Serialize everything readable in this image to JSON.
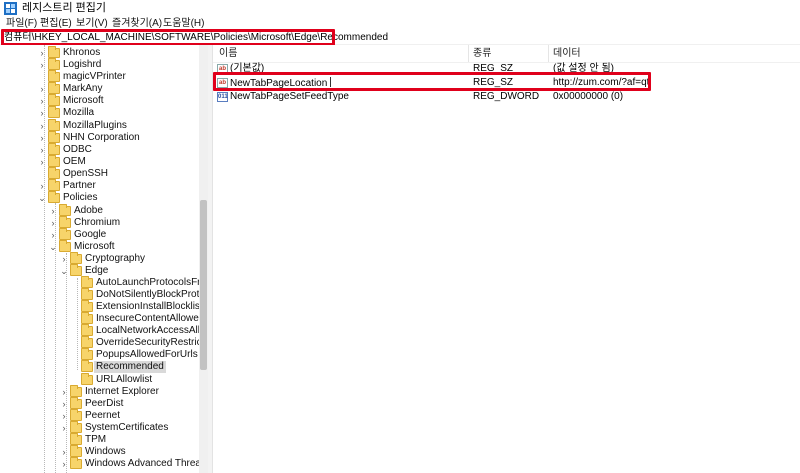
{
  "window": {
    "title": "레지스트리 편집기",
    "app_icon": "registry-icon"
  },
  "menu": [
    {
      "label": "파일(F)"
    },
    {
      "label": "편집(E)"
    },
    {
      "label": "보기(V)"
    },
    {
      "label": "즐겨찾기(A)"
    },
    {
      "label": "도움말(H)"
    }
  ],
  "address": {
    "path": "컴퓨터\\HKEY_LOCAL_MACHINE\\SOFTWARE\\Policies\\Microsoft\\Edge\\Recommended"
  },
  "tree": {
    "nodes": [
      {
        "label": "Khronos",
        "expander": "collapsed"
      },
      {
        "label": "Logishrd",
        "expander": "collapsed"
      },
      {
        "label": "magicVPrinter",
        "expander": "none"
      },
      {
        "label": "MarkAny",
        "expander": "collapsed"
      },
      {
        "label": "Microsoft",
        "expander": "collapsed"
      },
      {
        "label": "Mozilla",
        "expander": "collapsed"
      },
      {
        "label": "MozillaPlugins",
        "expander": "collapsed"
      },
      {
        "label": "NHN Corporation",
        "expander": "collapsed"
      },
      {
        "label": "ODBC",
        "expander": "collapsed"
      },
      {
        "label": "OEM",
        "expander": "collapsed"
      },
      {
        "label": "OpenSSH",
        "expander": "none"
      },
      {
        "label": "Partner",
        "expander": "collapsed"
      },
      {
        "label": "Policies",
        "expander": "expanded"
      },
      {
        "label": "Adobe",
        "expander": "collapsed"
      },
      {
        "label": "Chromium",
        "expander": "collapsed"
      },
      {
        "label": "Google",
        "expander": "collapsed"
      },
      {
        "label": "Microsoft",
        "expander": "expanded"
      },
      {
        "label": "Cryptography",
        "expander": "collapsed"
      },
      {
        "label": "Edge",
        "expander": "expanded"
      },
      {
        "label": "AutoLaunchProtocolsFromO",
        "expander": "none"
      },
      {
        "label": "DoNotSilentlyBlockProtocols",
        "expander": "none"
      },
      {
        "label": "ExtensionInstallBlocklist",
        "expander": "none"
      },
      {
        "label": "InsecureContentAllowedForU",
        "expander": "none"
      },
      {
        "label": "LocalNetworkAccessAllowed",
        "expander": "none"
      },
      {
        "label": "OverrideSecurityRestrictionsO",
        "expander": "none"
      },
      {
        "label": "PopupsAllowedForUrls",
        "expander": "none"
      },
      {
        "label": "Recommended",
        "expander": "none"
      },
      {
        "label": "URLAllowlist",
        "expander": "none"
      },
      {
        "label": "Internet Explorer",
        "expander": "collapsed"
      },
      {
        "label": "PeerDist",
        "expander": "collapsed"
      },
      {
        "label": "Peernet",
        "expander": "collapsed"
      },
      {
        "label": "SystemCertificates",
        "expander": "collapsed"
      },
      {
        "label": "TPM",
        "expander": "none"
      },
      {
        "label": "Windows",
        "expander": "collapsed"
      },
      {
        "label": "Windows Advanced Threat Prot",
        "expander": "collapsed"
      }
    ],
    "selected": "Recommended"
  },
  "list": {
    "columns": {
      "name": "이름",
      "type": "종류",
      "data": "데이터"
    },
    "rows": [
      {
        "name": "(기본값)",
        "type": "REG_SZ",
        "data": "(값 설정 안 됨)",
        "icon": "string-value-icon"
      },
      {
        "name": "NewTabPageLocation",
        "type": "REG_SZ",
        "data": "http://zum.com/?af=qt",
        "icon": "string-value-icon"
      },
      {
        "name": "NewTabPageSetFeedType",
        "type": "REG_DWORD",
        "data": "0x00000000 (0)",
        "icon": "dword-value-icon"
      }
    ]
  },
  "highlight_color": "#e0001b"
}
